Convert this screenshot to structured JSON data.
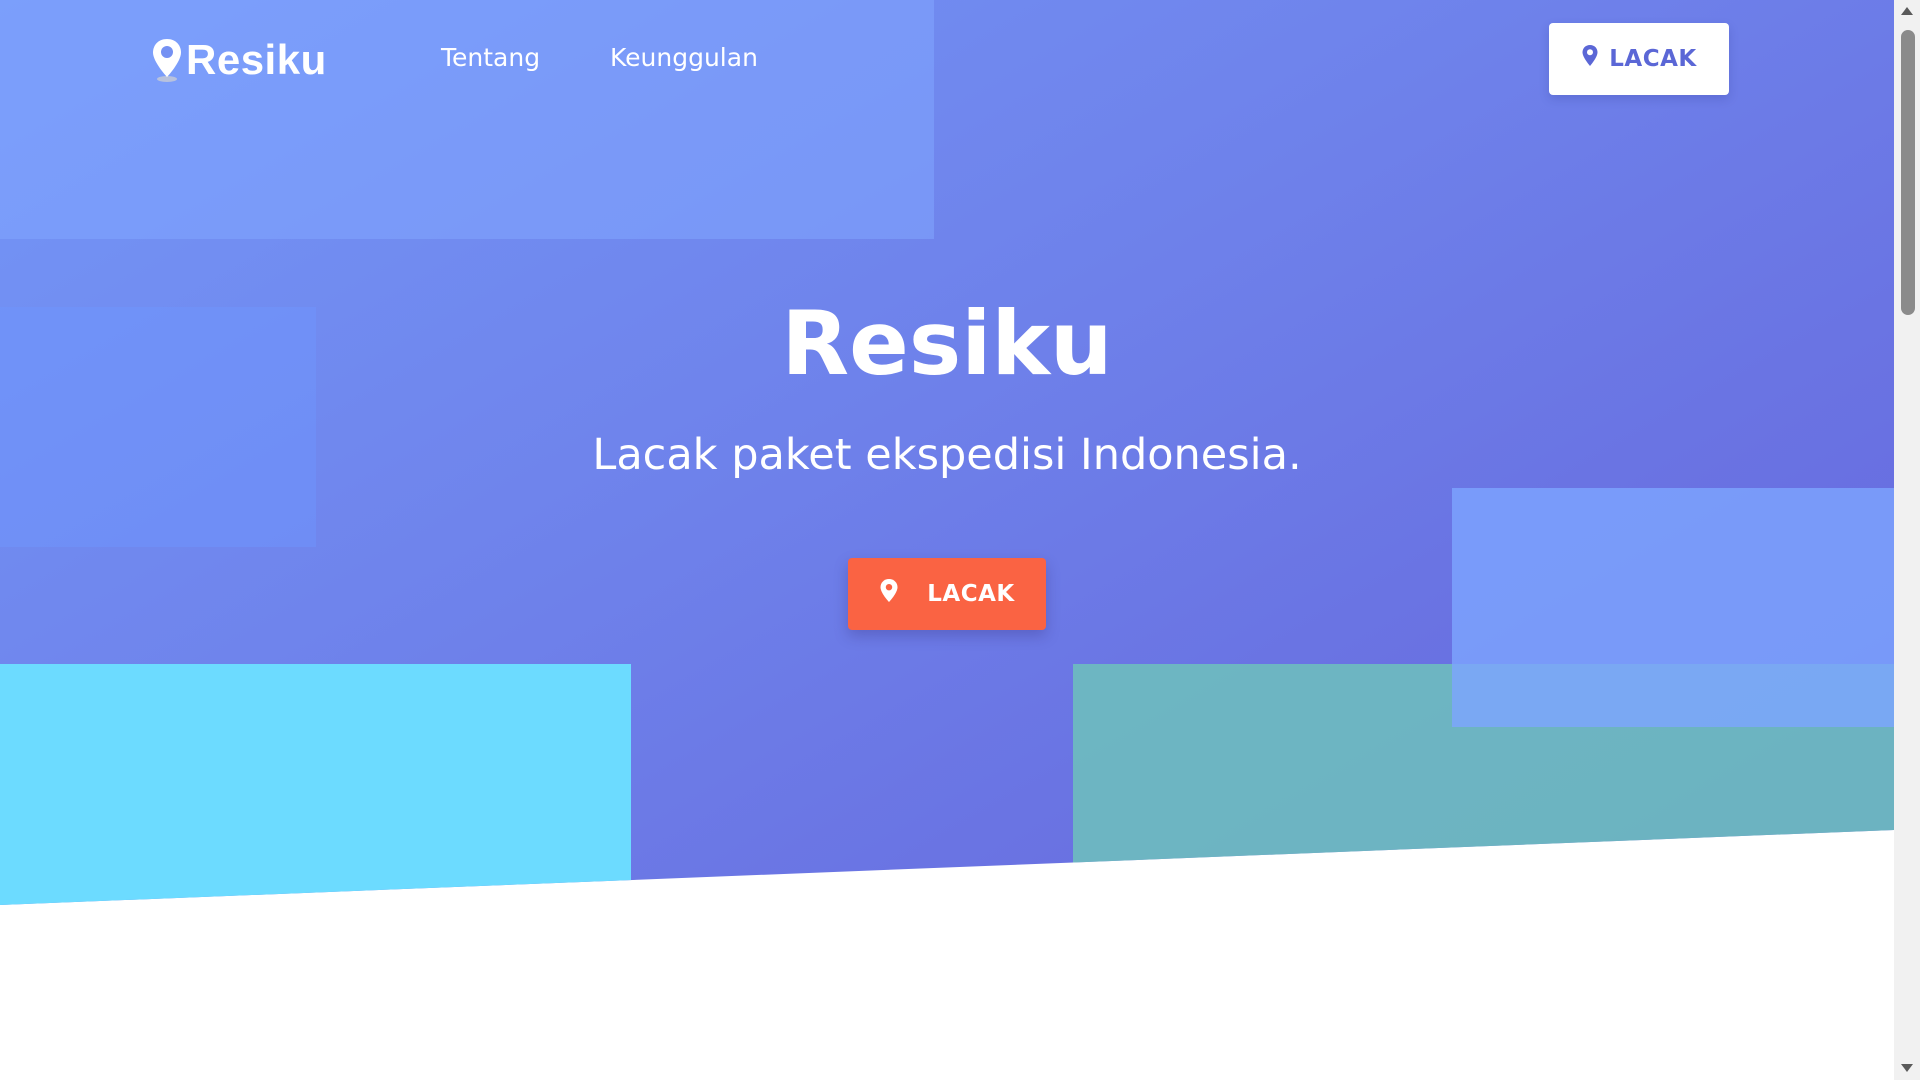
{
  "brand": {
    "name": "Resiku",
    "logo_icon": "location-pin-icon"
  },
  "nav": {
    "links": [
      "Tentang",
      "Keunggulan"
    ],
    "cta_label": "LACAK",
    "cta_icon": "location-pin-icon"
  },
  "hero": {
    "title": "Resiku",
    "subtitle": "Lacak paket ekspedisi Indonesia.",
    "cta_label": "LACAK",
    "cta_icon": "location-pin-icon"
  },
  "colors": {
    "hero_gradient_start": "#7497f7",
    "hero_gradient_end": "#6566dd",
    "cta_orange": "#fa6343",
    "nav_cta_text": "#5b67d6",
    "accent_cyan": "#6cdbff",
    "accent_teal": "#6ec8b9"
  }
}
